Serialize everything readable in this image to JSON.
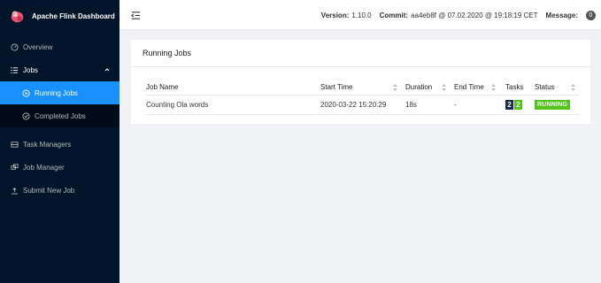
{
  "app": {
    "title": "Apache Flink Dashboard"
  },
  "sidebar": {
    "items": [
      {
        "label": "Overview",
        "icon": "dashboard-icon"
      },
      {
        "label": "Jobs",
        "icon": "list-icon",
        "expanded": true
      },
      {
        "label": "Running Jobs",
        "icon": "play-circle-icon",
        "active": true
      },
      {
        "label": "Completed Jobs",
        "icon": "check-circle-icon"
      },
      {
        "label": "Task Managers",
        "icon": "hdd-icon"
      },
      {
        "label": "Job Manager",
        "icon": "cluster-icon"
      },
      {
        "label": "Submit New Job",
        "icon": "upload-icon"
      }
    ]
  },
  "header": {
    "version_label": "Version:",
    "version_value": "1.10.0",
    "commit_label": "Commit:",
    "commit_value": "aa4eb8f @ 07.02.2020 @ 19:18:19 CET",
    "message_label": "Message:",
    "message_count": "0"
  },
  "card": {
    "title": "Running Jobs",
    "columns": [
      "Job Name",
      "Start Time",
      "Duration",
      "End Time",
      "Tasks",
      "Status"
    ],
    "rows": [
      {
        "job_name": "Counting Ola words",
        "start_time": "2020-03-22 15:20:29",
        "duration": "18s",
        "end_time": "-",
        "tasks_total": "2",
        "tasks_running": "2",
        "status": "RUNNING"
      }
    ]
  },
  "colors": {
    "sidebar_bg": "#001529",
    "accent": "#1890ff",
    "running": "#52c41a",
    "task_total": "#1a2a4a"
  }
}
